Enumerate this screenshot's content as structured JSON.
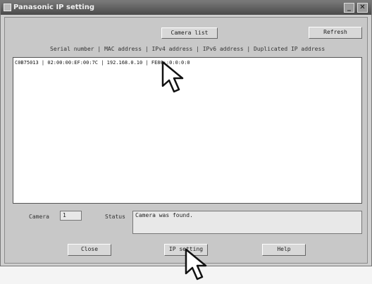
{
  "window": {
    "title": "Panasonic IP setting",
    "min_label": "_",
    "close_label": "✕"
  },
  "buttons": {
    "camera_list": "Camera list",
    "refresh": "Refresh",
    "close": "Close",
    "ip_setting": "IP setting",
    "help": "Help"
  },
  "list": {
    "header": "Serial number | MAC address | IPv4 address | IPv6 address | Duplicated IP address",
    "rows": [
      "C0B75013 | 02:00:00:EF:00:7C | 192.168.0.10 | FE80::0:0:0:0"
    ]
  },
  "counts": {
    "camera_label": "Camera",
    "camera_value": "1"
  },
  "status": {
    "label": "Status",
    "value": "Camera was found."
  }
}
